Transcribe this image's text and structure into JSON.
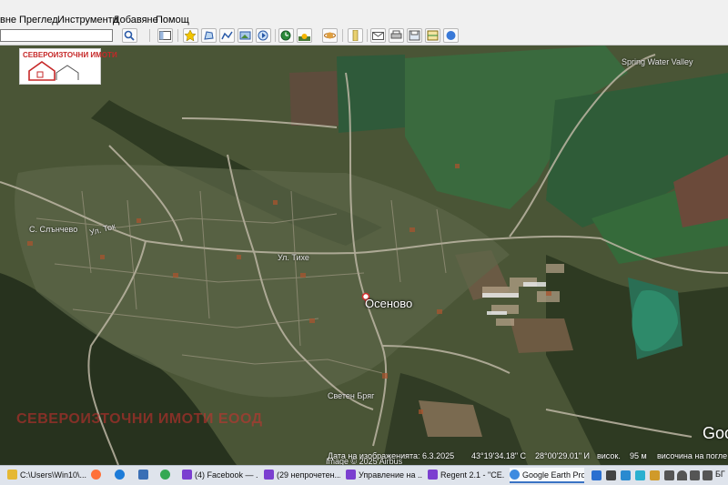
{
  "menu": {
    "items": [
      "вне",
      "Преглед",
      "Инструменти",
      "Добавяне",
      "Помощ"
    ]
  },
  "toolbar": {
    "search_value": "",
    "icons": [
      "sidebar-icon",
      "placemark-icon",
      "polygon-icon",
      "path-icon",
      "image-overlay-icon",
      "tour-icon",
      "historical-imagery-icon",
      "sunlight-icon",
      "planets-icon",
      "ruler-icon",
      "email-icon",
      "print-icon",
      "save-image-icon",
      "map-icon",
      "google-maps-icon"
    ]
  },
  "map": {
    "logo_text": "СЕВЕРОИЗТОЧНИ ИМОТИ",
    "place_label": "Осеново",
    "spring_label": "Spring Water Valley",
    "street_label_1": "С. Слънчево",
    "street_label_2": "Ул. Ток",
    "street_label_3": "Ул. Тихе",
    "street_label_4": "Светен Бряг",
    "watermark": "СЕВЕРОИЗТОЧНИ ИМОТИ ЕООД",
    "copyright": "Image © 2025 Airbus",
    "google": "Goo",
    "status": {
      "imagery_date": "Дата на изображенията: 6.3.2025",
      "latitude": "43°19'34.18\" С",
      "longitude": "28°00'29.01\" И",
      "elevation_label": "висок.",
      "elevation": "95 м",
      "eye_alt": "височина на погле"
    }
  },
  "taskbar": {
    "items": [
      {
        "label": "C:\\Users\\Win10\\...",
        "icon_color": "#e5b833"
      },
      {
        "label": "",
        "icon_color": "#ff7139"
      },
      {
        "label": "",
        "icon_color": "#1c7bd8"
      },
      {
        "label": "",
        "icon_color": "#3a6fb5"
      },
      {
        "label": "",
        "icon_color": "#34a853"
      },
      {
        "label": "(4) Facebook — ...",
        "icon_color": "#7b3fd0"
      },
      {
        "label": "(29 непрочетен...",
        "icon_color": "#7b3fd0"
      },
      {
        "label": "Управление на ...",
        "icon_color": "#7b3fd0"
      },
      {
        "label": "Regent 2.1 - \"CE...",
        "icon_color": "#7b3fd0"
      },
      {
        "label": "Google Earth Pro",
        "icon_color": "#3d8be0"
      }
    ],
    "tray_lang": "БГ"
  }
}
